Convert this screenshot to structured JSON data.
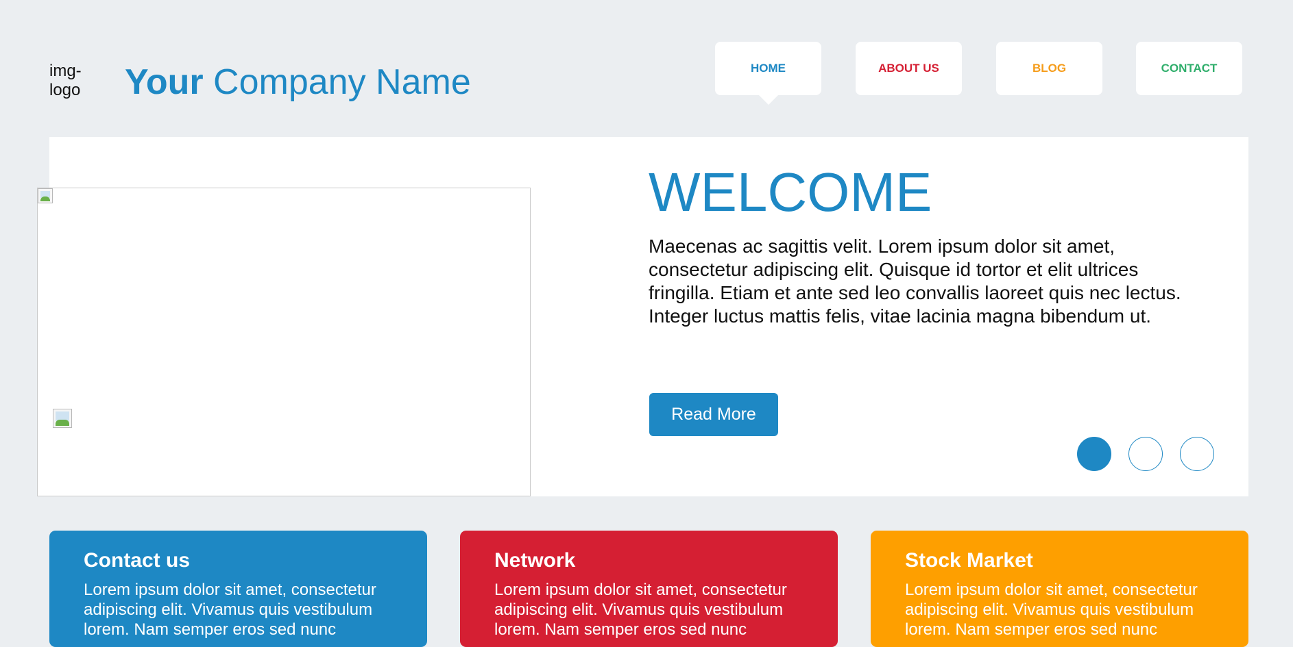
{
  "header": {
    "logo_alt": "img-logo",
    "company_bold": "Your",
    "company_rest": "Company Name"
  },
  "nav": {
    "items": [
      {
        "label": "HOME",
        "color": "#1e88c4",
        "active": true
      },
      {
        "label": "ABOUT US",
        "color": "#d51f33",
        "active": false
      },
      {
        "label": "BLOG",
        "color": "#f59c1a",
        "active": false
      },
      {
        "label": "CONTACT",
        "color": "#2fae6b",
        "active": false
      }
    ]
  },
  "hero": {
    "title": "WELCOME",
    "text": "Maecenas ac sagittis velit. Lorem ipsum dolor sit amet, consectetur adipiscing elit. Quisque id tortor et elit ultrices fringilla. Etiam et ante sed leo convallis laoreet quis nec lectus. Integer luctus mattis felis, vitae lacinia magna bibendum ut.",
    "button_label": "Read More",
    "slider": {
      "total": 3,
      "active": 1
    }
  },
  "cards": [
    {
      "title": "Contact us",
      "text": "Lorem ipsum dolor sit amet, consectetur adipiscing elit. Vivamus quis vestibulum lorem. Nam semper eros sed nunc",
      "color": "#1e88c4"
    },
    {
      "title": "Network",
      "text": "Lorem ipsum dolor sit amet, consectetur adipiscing elit. Vivamus quis vestibulum lorem. Nam semper eros sed nunc",
      "color": "#d51f33"
    },
    {
      "title": "Stock Market",
      "text": "Lorem ipsum dolor sit amet, consectetur adipiscing elit. Vivamus quis vestibulum lorem. Nam semper eros sed nunc",
      "color": "#fe9f00"
    }
  ],
  "colors": {
    "page_bg": "#ebeef1",
    "accent": "#1e88c4"
  }
}
